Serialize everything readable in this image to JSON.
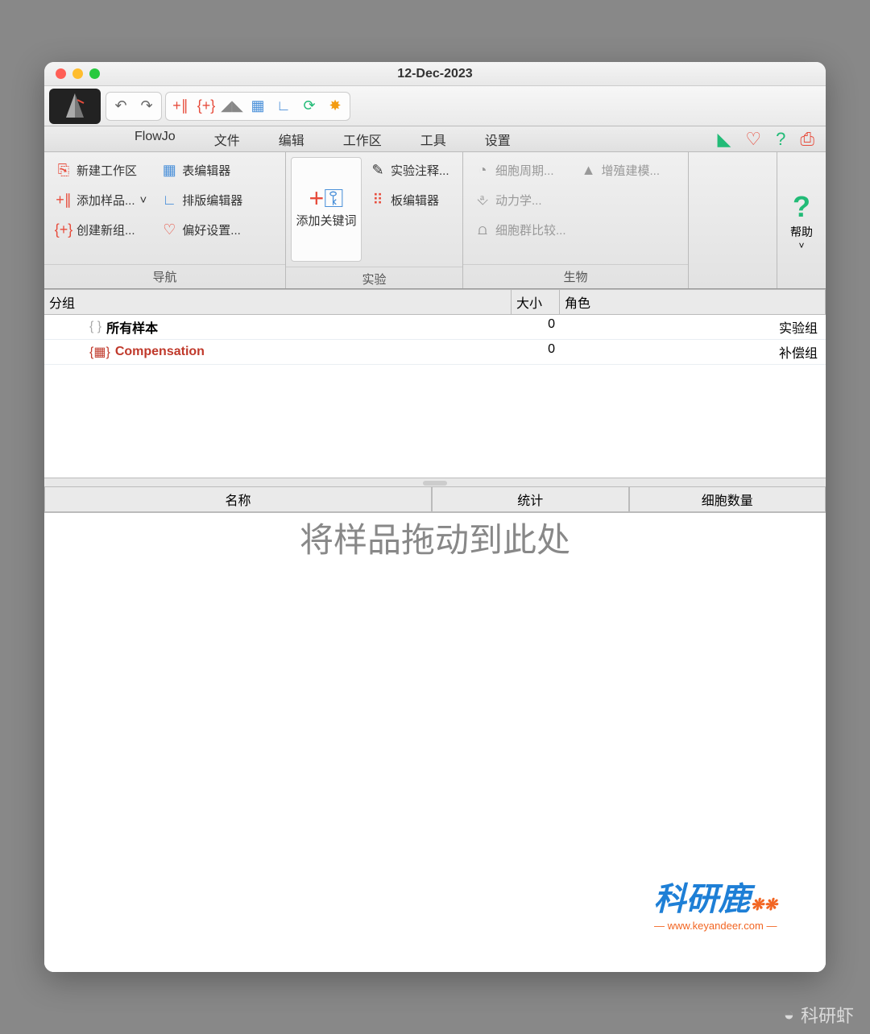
{
  "window": {
    "title": "12-Dec-2023"
  },
  "menu": {
    "items": [
      "FlowJo",
      "文件",
      "编辑",
      "工作区",
      "工具",
      "设置"
    ]
  },
  "ribbon": {
    "nav": {
      "label": "导航",
      "items": [
        "新建工作区",
        "添加样品...",
        "创建新组...",
        "表编辑器",
        "排版编辑器",
        "偏好设置..."
      ]
    },
    "experiment": {
      "label": "实验",
      "big": "添加关键词",
      "items": [
        "实验注释...",
        "板编辑器"
      ]
    },
    "biology": {
      "label": "生物",
      "items": [
        "细胞周期...",
        "动力学...",
        "细胞群比较...",
        "增殖建模..."
      ]
    },
    "help": {
      "label": "帮助"
    }
  },
  "grouping": {
    "headers": {
      "group": "分组",
      "size": "大小",
      "role": "角色"
    },
    "rows": [
      {
        "name": "所有样本",
        "size": "0",
        "role": "实验组",
        "class": ""
      },
      {
        "name": "Compensation",
        "size": "0",
        "role": "补偿组",
        "class": "compensation"
      }
    ]
  },
  "samples": {
    "headers": [
      "名称",
      "统计",
      "细胞数量"
    ],
    "drop_hint": "将样品拖动到此处"
  },
  "watermark": {
    "brand": "科研鹿",
    "url": "www.keyandeer.com",
    "channel": "科研虾"
  }
}
